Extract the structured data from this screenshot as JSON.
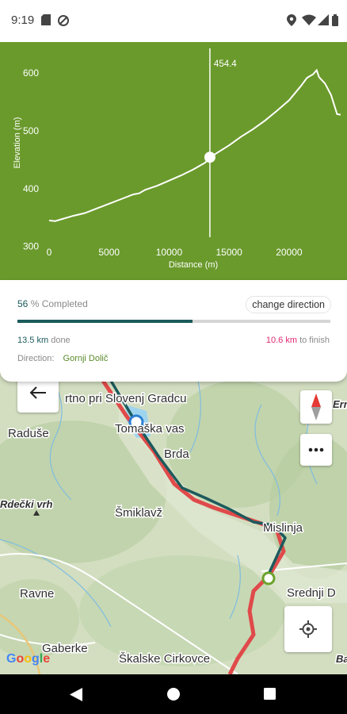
{
  "status_bar": {
    "time": "9:19",
    "left_icons": [
      "sd-card-icon",
      "no-location-icon"
    ],
    "right_icons": [
      "location-icon",
      "wifi-icon",
      "signal-icon",
      "battery-icon"
    ]
  },
  "elevation_chart": {
    "marker_label": "454.4",
    "colors": {
      "background": "#6a9a2c",
      "line": "#ffffff"
    }
  },
  "chart_data": {
    "type": "line",
    "xlabel": "Distance (m)",
    "ylabel": "Elevation (m)",
    "xlim": [
      0,
      24300
    ],
    "ylim": [
      290,
      640
    ],
    "x_ticks": [
      "0",
      "5000",
      "10000",
      "15000",
      "20000"
    ],
    "y_ticks": [
      "300",
      "400",
      "500",
      "600"
    ],
    "marker": {
      "x": 13400,
      "y": 454.4
    },
    "series": [
      {
        "x": [
          0,
          500,
          1000,
          2000,
          3000,
          4000,
          5000,
          6000,
          7000,
          7500,
          8000,
          9000,
          10000,
          11000,
          12000,
          13000,
          13400,
          14000,
          15000,
          16000,
          17000,
          18000,
          19000,
          20000,
          21000,
          21500,
          22000,
          22300,
          22500,
          23000,
          23500,
          24000,
          24300
        ],
        "y": [
          345,
          344,
          347,
          353,
          358,
          366,
          374,
          382,
          390,
          392,
          398,
          405,
          414,
          423,
          433,
          445,
          454,
          462,
          475,
          490,
          503,
          518,
          535,
          553,
          578,
          592,
          598,
          605,
          593,
          582,
          562,
          529,
          528
        ]
      }
    ]
  },
  "progress": {
    "percent": "56",
    "completed_label": "% Completed",
    "change_direction_label": "change direction",
    "fraction": 0.56,
    "done_km": "13.5 km",
    "done_label": "done",
    "finish_km": "10.6 km",
    "finish_label": "to finish",
    "direction_label": "Direction:",
    "direction_value": "Gornji Dolič",
    "colors": {
      "done": "#1c5a5c",
      "finish": "#e02a72",
      "direction": "#5a8a2a"
    }
  },
  "map": {
    "labels": {
      "slovenj": "rtno pri Slovenj Gradcu",
      "tomaska": "Tomaška vas",
      "brda": "Brda",
      "raduse": "Raduše",
      "rdecki": "Rdečki vrh",
      "smiklavz": "Šmiklavž",
      "mislinja": "Mislinja",
      "srednji": "Srednji D",
      "ravne": "Ravne",
      "gaberke": "Gaberke",
      "skalske": "Škalske Cirkovce",
      "ern": "Ern",
      "b": "Ba"
    },
    "google_logo": "Google",
    "colors": {
      "route_red": "#e04a4a",
      "route_teal": "#1c5a5c",
      "water": "#9fd4ef"
    }
  },
  "nav_bar": {
    "buttons": [
      "back-triangle-icon",
      "home-circle-icon",
      "recents-square-icon"
    ]
  }
}
